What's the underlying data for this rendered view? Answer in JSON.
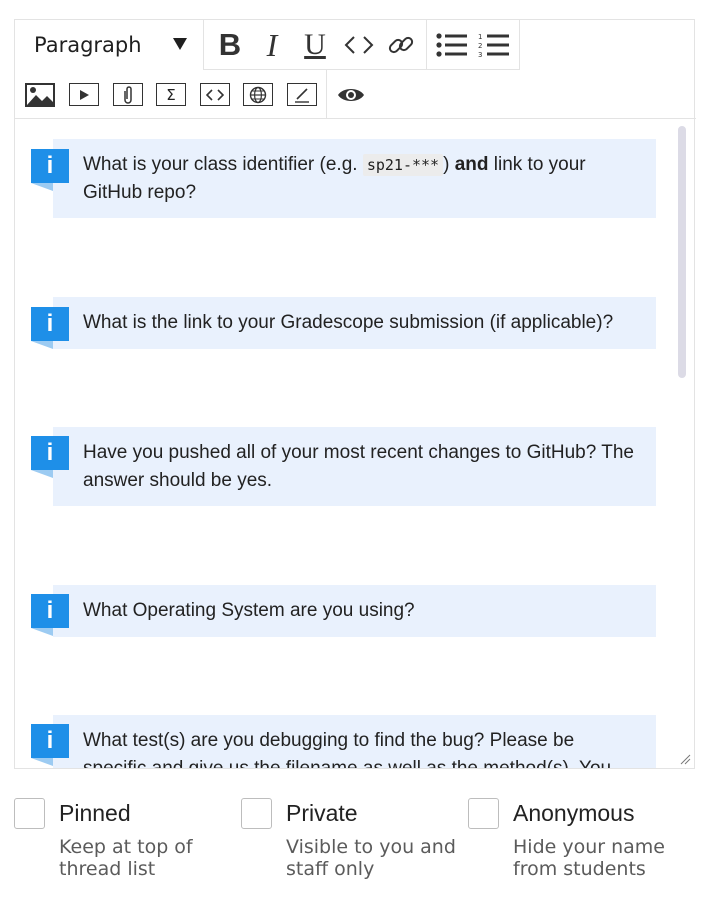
{
  "toolbar": {
    "paragraph_select": "Paragraph",
    "format_buttons": {
      "bold": "B",
      "italic": "I",
      "underline": "U"
    },
    "insert_buttons": {
      "math": "Σ"
    }
  },
  "callouts": [
    {
      "before": "What is your class identifier (e.g. ",
      "code": "sp21-***",
      "middle": ") ",
      "bold": "and",
      "after": " link to your GitHub repo?"
    },
    {
      "text": "What is the link to your Gradescope submission (if applicable)?"
    },
    {
      "text": "Have you pushed all of your most recent changes to GitHub? The answer should be yes."
    },
    {
      "text": "What Operating System are you using?"
    },
    {
      "text": "What test(s) are you debugging to find the bug? Please be specific and give us the filename as well as the method(s). You"
    }
  ],
  "info_glyph": "i",
  "options": [
    {
      "label": "Pinned",
      "description": "Keep at top of thread list"
    },
    {
      "label": "Private",
      "description": "Visible to you and staff only"
    },
    {
      "label": "Anonymous",
      "description": "Hide your name from students"
    }
  ]
}
